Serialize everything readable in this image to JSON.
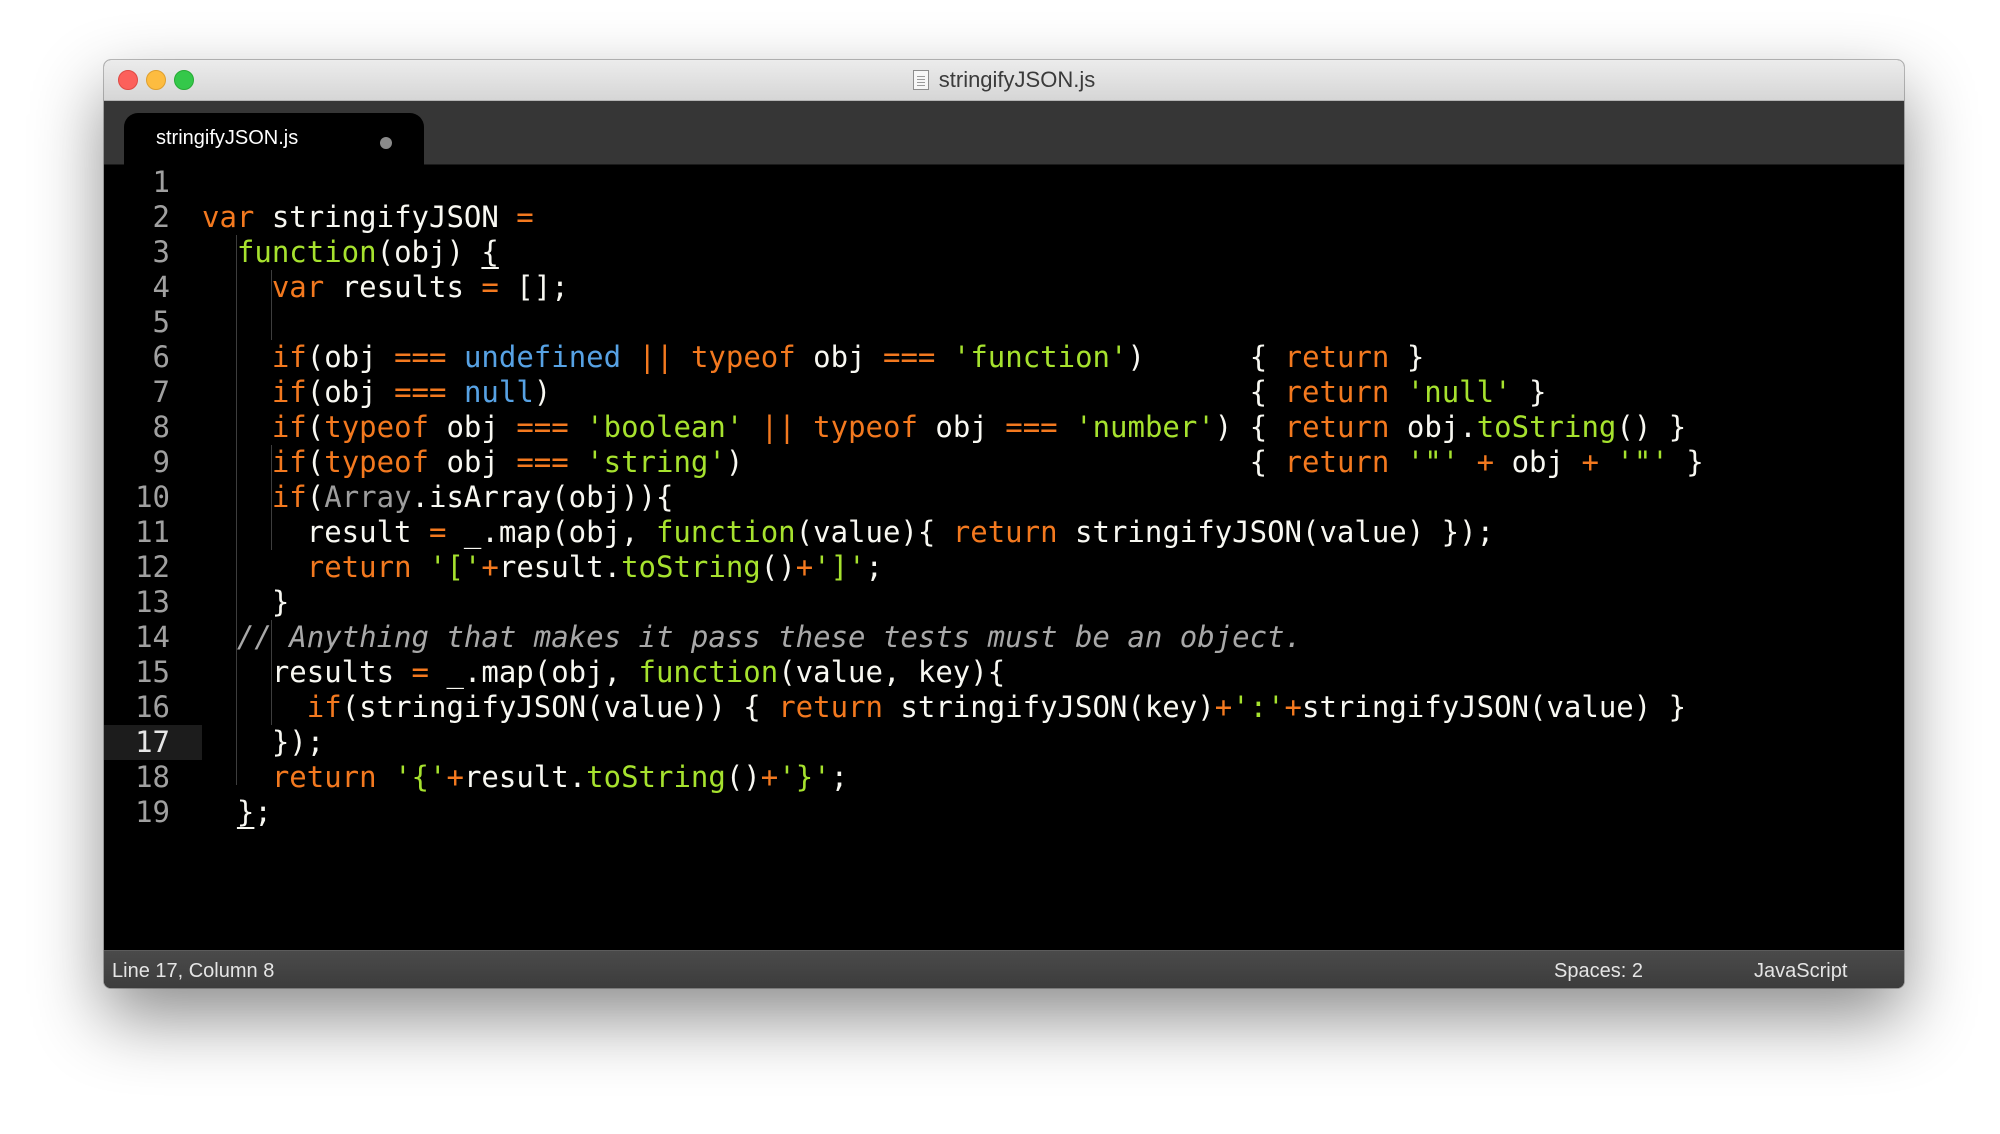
{
  "window": {
    "title": "stringifyJSON.js"
  },
  "tab": {
    "label": "stringifyJSON.js",
    "dirty_indicator": "●"
  },
  "editor": {
    "current_line": 17,
    "lines": [
      "",
      "var stringifyJSON =",
      "  function(obj) {",
      "    var results = [];",
      "",
      "    if(obj === undefined || typeof obj === 'function')      { return }",
      "    if(obj === null)                                        { return 'null' }",
      "    if(typeof obj === 'boolean' || typeof obj === 'number') { return obj.toString() }",
      "    if(typeof obj === 'string')                             { return '\"' + obj + '\"' }",
      "    if(Array.isArray(obj)){",
      "      result = _.map(obj, function(value){ return stringifyJSON(value) });",
      "      return '['+result.toString()+']';",
      "    }",
      "  // Anything that makes it pass these tests must be an object.",
      "    results = _.map(obj, function(value, key){",
      "      if(stringifyJSON(value)) { return stringifyJSON(key)+':'+stringifyJSON(value) }",
      "    });",
      "    return '{'+result.toString()+'}';",
      "  };"
    ]
  },
  "status": {
    "position": "Line 17, Column 8",
    "indentation": "Spaces: 2",
    "syntax": "JavaScript"
  },
  "colors": {
    "background": "#000000",
    "keyword": "#f3791f",
    "function_and_string": "#a6e22e",
    "constant": "#57a2e4",
    "comment": "#a8a8a8",
    "text": "#f8f8f2"
  }
}
